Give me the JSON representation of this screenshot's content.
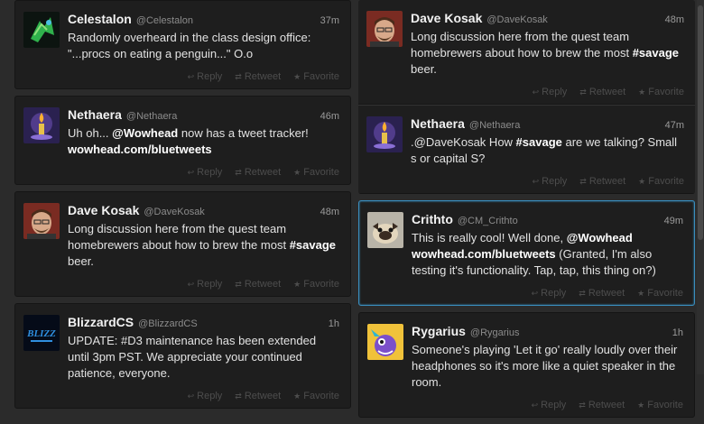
{
  "columns": {
    "left": [
      {
        "name": "Celestalon",
        "handle": "@Celestalon",
        "time": "37m",
        "avatar": "celestalon-avatar",
        "text": [
          {
            "t": "Randomly overheard in the class design office: \"...procs on eating a penguin...\" O.o"
          }
        ]
      },
      {
        "name": "Nethaera",
        "handle": "@Nethaera",
        "time": "46m",
        "avatar": "candle-avatar",
        "text": [
          {
            "t": "Uh oh... "
          },
          {
            "t": "@Wowhead",
            "b": true
          },
          {
            "t": " now has a tweet tracker! "
          },
          {
            "t": "wowhead.com/bluetweets",
            "b": true
          }
        ]
      },
      {
        "name": "Dave Kosak",
        "handle": "@DaveKosak",
        "time": "48m",
        "avatar": "face-avatar",
        "text": [
          {
            "t": "Long discussion here from the quest team homebrewers about how to brew the most "
          },
          {
            "t": "#savage",
            "b": true
          },
          {
            "t": " beer."
          }
        ]
      },
      {
        "name": "BlizzardCS",
        "handle": "@BlizzardCS",
        "time": "1h",
        "avatar": "blizzard-avatar",
        "text": [
          {
            "t": "UPDATE: #D3 maintenance has been extended until 3pm PST. We appreciate your continued patience, everyone."
          }
        ]
      }
    ],
    "right_group": [
      {
        "name": "Dave Kosak",
        "handle": "@DaveKosak",
        "time": "48m",
        "avatar": "face-avatar",
        "text": [
          {
            "t": "Long discussion here from the quest team homebrewers about how to brew the most "
          },
          {
            "t": "#savage",
            "b": true
          },
          {
            "t": " beer."
          }
        ]
      },
      {
        "name": "Nethaera",
        "handle": "@Nethaera",
        "time": "47m",
        "avatar": "candle-avatar",
        "text": [
          {
            "t": " ."
          },
          {
            "t": "@DaveKosak",
            "b": false
          },
          {
            "t": " How "
          },
          {
            "t": "#savage",
            "b": true
          },
          {
            "t": " are we talking? Small s or capital S?"
          }
        ]
      }
    ],
    "right": [
      {
        "name": "Crithto",
        "handle": "@CM_Crithto",
        "time": "49m",
        "avatar": "pug-avatar",
        "highlight": true,
        "text": [
          {
            "t": "This is really cool! Well done, "
          },
          {
            "t": "@Wowhead wowhead.com/bluetweets",
            "b": true
          },
          {
            "t": " (Granted, I'm also testing it's functionality. Tap, tap, this thing on?)"
          }
        ]
      },
      {
        "name": "Rygarius",
        "handle": "@Rygarius",
        "time": "1h",
        "avatar": "cartoon-avatar",
        "text": [
          {
            "t": "Someone's playing 'Let it go' really loudly over their headphones so it's more like a quiet speaker in the room."
          }
        ]
      }
    ]
  },
  "actions": {
    "reply": "Reply",
    "retweet": "Retweet",
    "favorite": "Favorite"
  },
  "colors": {
    "accent": "#3a8dbd",
    "background": "#2b2b2b",
    "card": "#1e1e1e"
  }
}
